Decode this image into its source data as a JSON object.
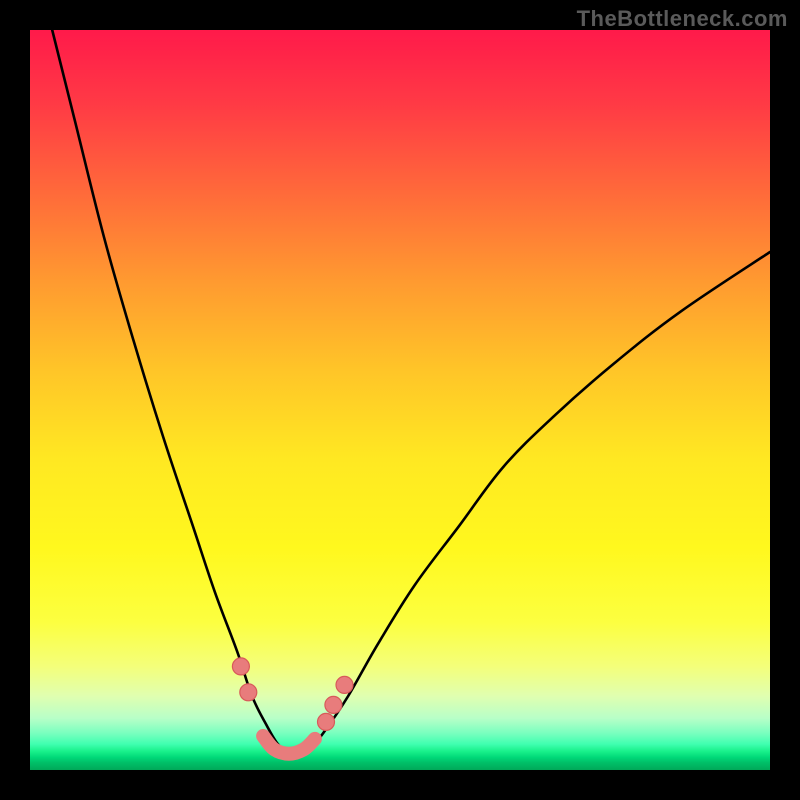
{
  "watermark": "TheBottleneck.com",
  "chart_data": {
    "type": "line",
    "title": "",
    "xlabel": "",
    "ylabel": "",
    "xlim": [
      0,
      100
    ],
    "ylim": [
      0,
      100
    ],
    "grid": false,
    "series": [
      {
        "name": "bottleneck-curve",
        "x": [
          3,
          6,
          10,
          14,
          18,
          22,
          25,
          28,
          30,
          32,
          33.5,
          35,
          36.5,
          38,
          40,
          43,
          47,
          52,
          58,
          64,
          71,
          79,
          88,
          100
        ],
        "y": [
          100,
          88,
          72,
          58,
          45,
          33,
          24,
          16,
          10,
          6,
          3.5,
          2.2,
          2.2,
          3.0,
          5.5,
          10,
          17,
          25,
          33,
          41,
          48,
          55,
          62,
          70
        ]
      }
    ],
    "markers": {
      "name": "marker-dots",
      "points": [
        {
          "x": 28.5,
          "y": 14
        },
        {
          "x": 29.5,
          "y": 10.5
        },
        {
          "x": 40.0,
          "y": 6.5
        },
        {
          "x": 41.0,
          "y": 8.8
        },
        {
          "x": 42.5,
          "y": 11.5
        }
      ]
    },
    "valley": {
      "name": "valley-highlight",
      "x": [
        31.5,
        33,
        35,
        37,
        38.5
      ],
      "y": [
        4.6,
        2.8,
        2.2,
        2.8,
        4.2
      ]
    },
    "colors": {
      "curve": "#000000",
      "marker_fill": "#e87c7c",
      "marker_stroke": "#d85a5a",
      "gradient_top": "#ff1a4a",
      "gradient_mid": "#ffe822",
      "gradient_bottom": "#00a858"
    }
  }
}
